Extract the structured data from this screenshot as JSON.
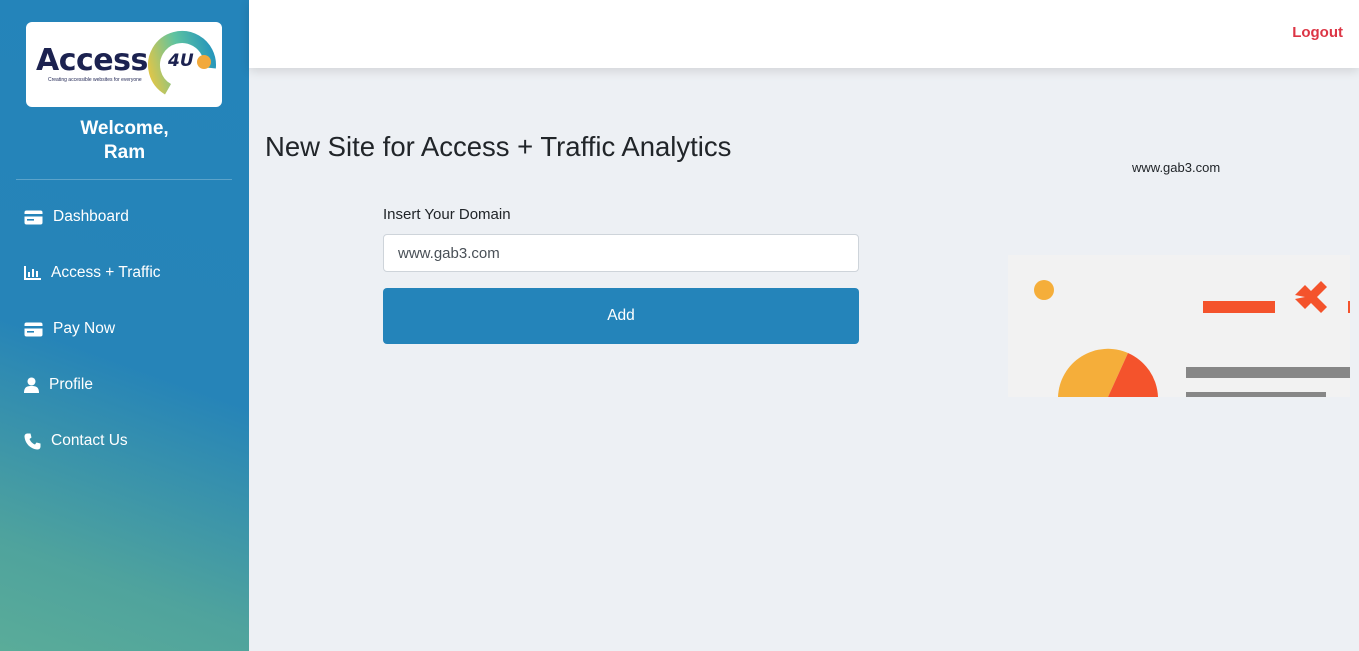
{
  "brand": {
    "logo_text": "Access",
    "logo_badge": "4U",
    "logo_tagline": "Creating accessible websites for everyone"
  },
  "sidebar": {
    "welcome_line1": "Welcome,",
    "welcome_line2": "Ram",
    "items": [
      {
        "label": "Dashboard",
        "icon": "credit-card-icon"
      },
      {
        "label": "Access + Traffic",
        "icon": "bar-chart-icon"
      },
      {
        "label": "Pay Now",
        "icon": "credit-card-icon"
      },
      {
        "label": "Profile",
        "icon": "user-icon"
      },
      {
        "label": "Contact Us",
        "icon": "phone-icon"
      }
    ]
  },
  "header": {
    "logout_label": "Logout"
  },
  "main": {
    "title": "New Site for Access + Traffic Analytics",
    "domain_display": "www.gab3.com",
    "form": {
      "label": "Insert Your Domain",
      "value": "www.gab3.com",
      "button_label": "Add"
    }
  },
  "colors": {
    "sidebar": "#2484ba",
    "button": "#2484ba",
    "logout": "#dc3545",
    "background": "#edf0f4"
  }
}
